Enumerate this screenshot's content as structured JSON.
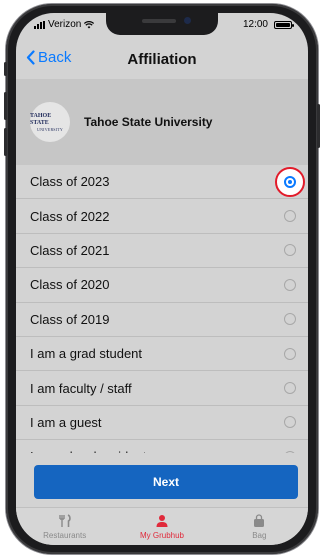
{
  "status_bar": {
    "carrier": "Verizon",
    "time": "12:00"
  },
  "navbar": {
    "back_label": "Back",
    "title": "Affiliation"
  },
  "university": {
    "logo_line1": "TAHOE STATE",
    "logo_line2": "UNIVERSITY",
    "name": "Tahoe State University"
  },
  "options": [
    {
      "label": "Class of 2023",
      "selected": true
    },
    {
      "label": "Class of 2022",
      "selected": false
    },
    {
      "label": "Class of 2021",
      "selected": false
    },
    {
      "label": "Class of 2020",
      "selected": false
    },
    {
      "label": "Class of 2019",
      "selected": false
    },
    {
      "label": "I am a grad student",
      "selected": false
    },
    {
      "label": "I am faculty / staff",
      "selected": false
    },
    {
      "label": "I am a guest",
      "selected": false
    }
  ],
  "partial_option": "I am a local resident",
  "next_label": "Next",
  "tabs": [
    {
      "label": "Restaurants",
      "icon": "utensils-icon",
      "active": false
    },
    {
      "label": "My Grubhub",
      "icon": "person-icon",
      "active": true
    },
    {
      "label": "Bag",
      "icon": "bag-icon",
      "active": false
    }
  ],
  "colors": {
    "accent_blue": "#0a7aff",
    "button_blue": "#1565c0",
    "highlight_red": "#e21b2a",
    "active_tab_red": "#e02a3b"
  }
}
